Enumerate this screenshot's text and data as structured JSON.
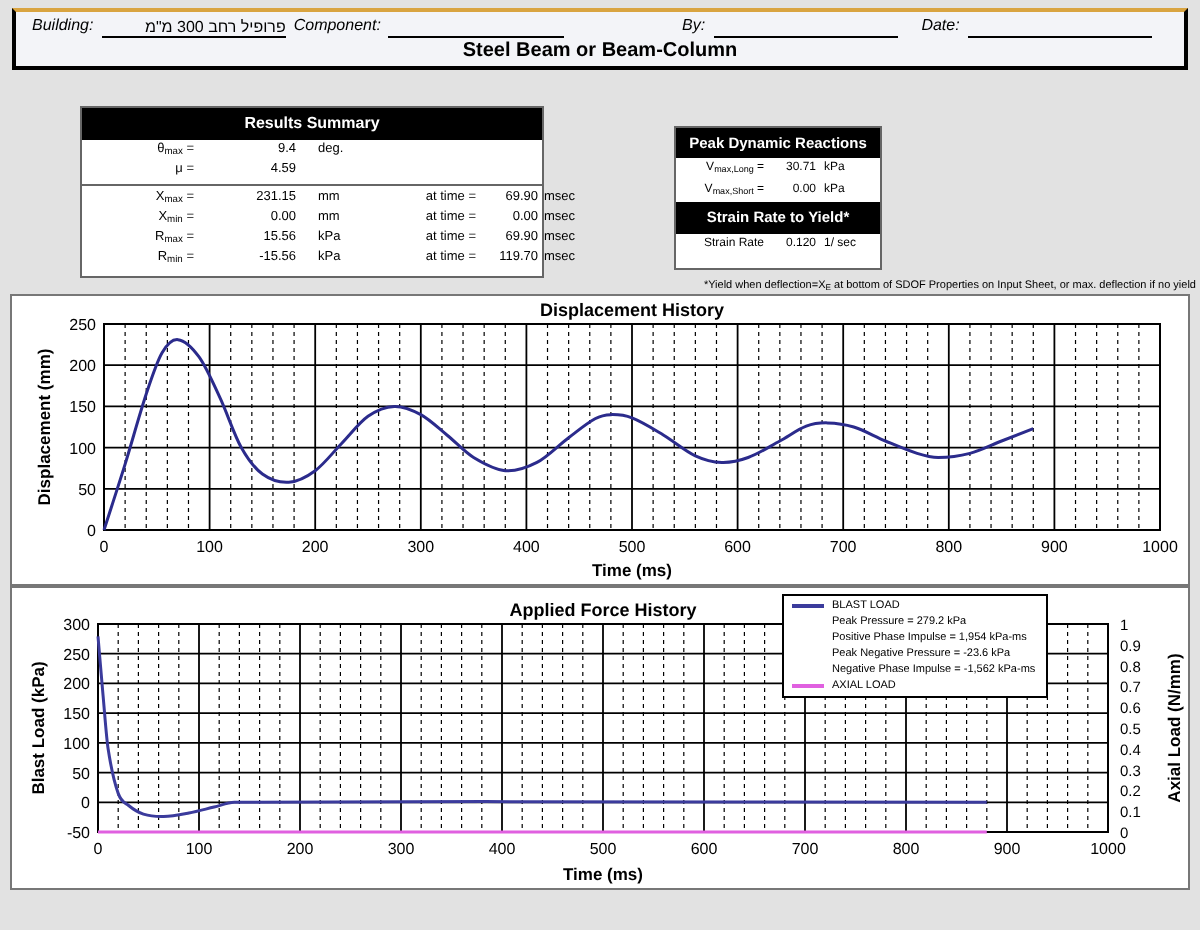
{
  "header": {
    "fields": [
      {
        "label": "Building:",
        "value": "פרופיל רחב 300 מ\"מ"
      },
      {
        "label": "Component:"
      },
      {
        "label": "By:"
      },
      {
        "label": "Date:"
      }
    ],
    "title": "Steel Beam or Beam-Column"
  },
  "results_summary": {
    "title": "Results Summary",
    "rows": [
      {
        "label": "θ$_{max}$ =",
        "value": "9.4",
        "unit": "deg."
      },
      {
        "label": "μ =",
        "value": "4.59"
      },
      {
        "label": "X$_{max}$ =",
        "value": "231.15",
        "unit": "mm",
        "at": "at time =",
        "time": "69.90",
        "time_unit": "msec"
      },
      {
        "label": "X$_{min}$ =",
        "value": "0.00",
        "unit": "mm",
        "at": "at time =",
        "time": "0.00",
        "time_unit": "msec"
      },
      {
        "label": "R$_{max}$ =",
        "value": "15.56",
        "unit": "kPa",
        "at": "at time =",
        "time": "69.90",
        "time_unit": "msec"
      },
      {
        "label": "R$_{min}$ =",
        "value": "-15.56",
        "unit": "kPa",
        "at": "at time =",
        "time": "119.70",
        "time_unit": "msec"
      }
    ]
  },
  "peak_reactions": {
    "title": "Peak Dynamic Reactions",
    "rows": [
      {
        "label": "V$_{max,Long}$ =",
        "value": "30.71",
        "unit": "kPa"
      },
      {
        "label": "V$_{max,Short}$ =",
        "value": "0.00",
        "unit": "kPa"
      }
    ]
  },
  "strain_rate": {
    "title": "Strain Rate to Yield*",
    "label": "Strain Rate",
    "value": "0.120",
    "unit": "1/ sec"
  },
  "footnote": "*Yield when deflection=X$_{E}$ at bottom of SDOF Properties on Input Sheet, or max. deflection if no yield",
  "displacement_chart": {
    "chart_data": {
      "type": "line",
      "title": "Displacement History",
      "xlabel": "Time (ms)",
      "ylabel": "Displacement (mm)",
      "x": [
        0,
        20,
        40,
        55,
        70,
        90,
        110,
        130,
        150,
        175,
        200,
        225,
        250,
        275,
        300,
        325,
        350,
        380,
        410,
        440,
        465,
        480,
        500,
        530,
        560,
        585,
        610,
        640,
        665,
        685,
        710,
        740,
        770,
        790,
        820,
        850,
        880
      ],
      "grid": true,
      "series": [
        {
          "color": "#2b2b8c",
          "values": [
            0,
            80,
            165,
            215,
            231,
            210,
            160,
            100,
            68,
            58,
            72,
            105,
            138,
            150,
            140,
            115,
            88,
            72,
            82,
            112,
            135,
            140,
            136,
            115,
            90,
            82,
            88,
            108,
            126,
            130,
            125,
            108,
            93,
            88,
            93,
            108,
            123
          ]
        }
      ],
      "xlim": [
        0,
        1000
      ],
      "ylim": [
        0,
        250
      ],
      "xticks": [
        0,
        100,
        200,
        300,
        400,
        500,
        600,
        700,
        800,
        900,
        1000
      ],
      "yticks": [
        0,
        50,
        100,
        150,
        200,
        250
      ]
    }
  },
  "force_chart": {
    "chart_data": {
      "type": "line",
      "title": "Applied Force History",
      "xlabel": "Time (ms)",
      "ylabel": "Blast Load (kPa)",
      "y2label": "Axial Load (N/mm)",
      "x": [
        0,
        5,
        10,
        20,
        30,
        45,
        65,
        90,
        115,
        135,
        880
      ],
      "series": [
        {
          "name": "BLAST LOAD",
          "color": "#3b3b9c",
          "values": [
            279,
            180,
            90,
            15,
            -5,
            -20,
            -24,
            -18,
            -8,
            0,
            0
          ]
        },
        {
          "name": "AXIAL LOAD",
          "color": "#e060e0",
          "axis": "y2",
          "values": [
            0,
            0,
            0,
            0,
            0,
            0,
            0,
            0,
            0,
            0,
            0
          ]
        }
      ],
      "grid": true,
      "xlim": [
        0,
        1000
      ],
      "ylim": [
        -50,
        300
      ],
      "y2lim": [
        0,
        1
      ],
      "xticks": [
        0,
        100,
        200,
        300,
        400,
        500,
        600,
        700,
        800,
        900,
        1000
      ],
      "yticks": [
        -50,
        0,
        50,
        100,
        150,
        200,
        250,
        300
      ],
      "y2ticks": [
        0,
        0.1,
        0.2,
        0.3,
        0.4,
        0.5,
        0.6,
        0.7,
        0.8,
        0.9,
        1
      ]
    },
    "legend_notes": [
      "Peak Pressure = 279.2 kPa",
      "Positive Phase Impulse = 1,954 kPa-ms",
      "Peak Negative Pressure = -23.6 kPa",
      "Negative Phase Impulse = -1,562 kPa-ms"
    ]
  }
}
